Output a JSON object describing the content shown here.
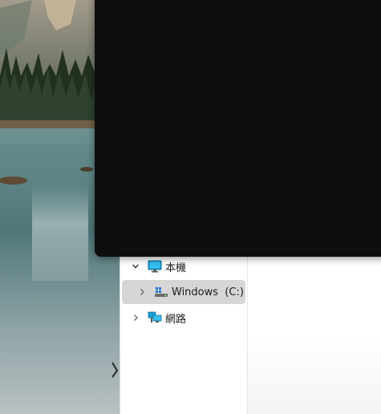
{
  "desktop": {
    "wallpaper_colors": {
      "sky": "#9fb3bb",
      "mountain": "#8a8f87",
      "forest": "#2b3a2c",
      "water": "#5f8585",
      "shore": "#7c6a4e"
    }
  },
  "overlay_window": {
    "background": "#0e0e0e"
  },
  "explorer": {
    "nav_tree": {
      "items": [
        {
          "label": "本機",
          "icon": "this-pc-icon",
          "expanded": true,
          "selected": false
        },
        {
          "label": "Windows  (C:)",
          "icon": "windows-drive-icon",
          "expanded": false,
          "selected": true
        },
        {
          "label": "網路",
          "icon": "network-icon",
          "expanded": false,
          "selected": false
        }
      ]
    },
    "colors": {
      "selected_background": "#d6d6d6",
      "text": "#1b1b1b"
    }
  }
}
